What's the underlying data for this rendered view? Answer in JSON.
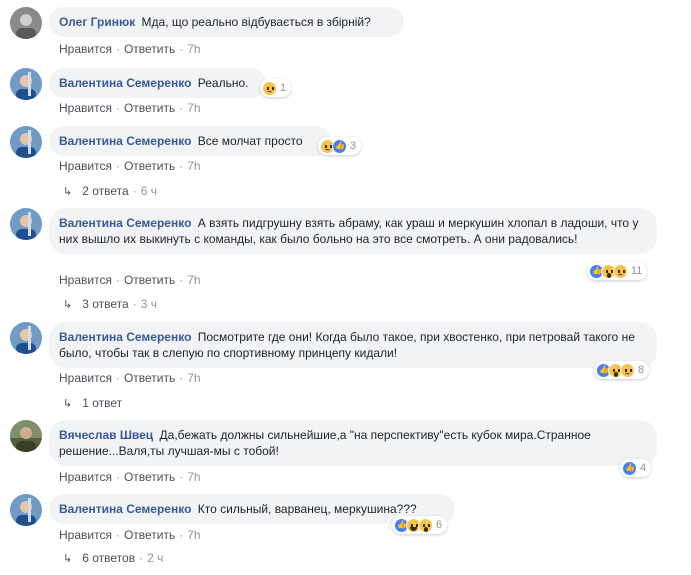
{
  "action_labels": {
    "like": "Нравится",
    "reply": "Ответить"
  },
  "comments": [
    {
      "author": "Олег Гринюк",
      "text": "Мда, що реально відбувається в збірній?",
      "time": "7h",
      "avatar": "grey-avatar"
    },
    {
      "author": "Валентина Семеренко",
      "text": "Реально.",
      "time": "7h",
      "avatar": "biathlon-avatar",
      "reactions": {
        "icons": [
          "sad"
        ],
        "count": "1"
      }
    },
    {
      "author": "Валентина Семеренко",
      "text": "Все молчат просто",
      "time": "7h",
      "avatar": "biathlon-avatar",
      "reactions": {
        "icons": [
          "sad",
          "like"
        ],
        "count": "3"
      },
      "replies": {
        "label": "2 ответа",
        "time": "6 ч"
      }
    },
    {
      "author": "Валентина Семеренко",
      "text": "А взять пидгрушну взять абраму, как ураш и меркушин хлопал в ладоши, что у них вышло их выкинуть с команды, как было больно на это все смотреть. А они радовались!",
      "time": "7h",
      "avatar": "biathlon-avatar",
      "reactions": {
        "icons": [
          "like",
          "wow",
          "sad"
        ],
        "count": "11"
      },
      "replies": {
        "label": "3 ответа",
        "time": "3 ч"
      }
    },
    {
      "author": "Валентина Семеренко",
      "text": "Посмотрите где они! Когда было такое, при хвостенко, при петровай такого не было, чтобы так в слепую по спортивному принцепу кидали!",
      "time": "7h",
      "avatar": "biathlon-avatar",
      "reactions": {
        "icons": [
          "like",
          "wow",
          "sad"
        ],
        "count": "8"
      },
      "replies": {
        "label": "1 ответ",
        "time": ""
      }
    },
    {
      "author": "Вячеслав Швец",
      "text": "Да,бежать должны сильнейшие,а \"на перспективу\"есть кубок мира.Странное решение...Валя,ты лучшая-мы с тобой!",
      "time": "7h",
      "avatar": "outdoor-avatar",
      "reactions": {
        "icons": [
          "like"
        ],
        "count": "4"
      }
    },
    {
      "author": "Валентина Семеренко",
      "text": "Кто сильный, варванец, меркушина???",
      "time": "7h",
      "avatar": "biathlon-avatar",
      "reactions": {
        "icons": [
          "like",
          "haha",
          "wow"
        ],
        "count": "6"
      },
      "replies": {
        "label": "6 ответов",
        "time": "2 ч"
      }
    }
  ]
}
